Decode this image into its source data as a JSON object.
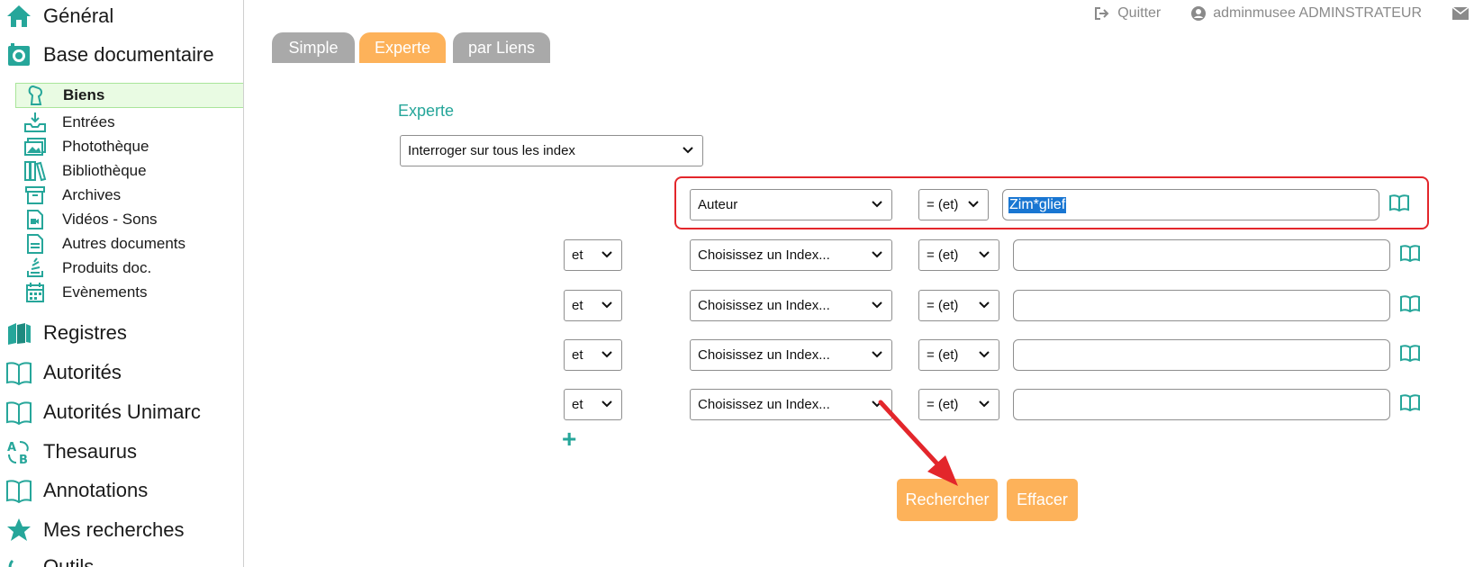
{
  "sidebar": {
    "sections_top": [
      {
        "label": "Général",
        "icon": "home-icon"
      },
      {
        "label": "Base documentaire",
        "icon": "database-icon"
      }
    ],
    "sub_items": [
      {
        "label": "Biens",
        "icon": "statue-icon",
        "active": true
      },
      {
        "label": "Entrées",
        "icon": "inbox-icon"
      },
      {
        "label": "Photothèque",
        "icon": "images-icon"
      },
      {
        "label": "Bibliothèque",
        "icon": "books-icon"
      },
      {
        "label": "Archives",
        "icon": "archive-box-icon"
      },
      {
        "label": "Vidéos - Sons",
        "icon": "video-file-icon"
      },
      {
        "label": "Autres documents",
        "icon": "document-icon"
      },
      {
        "label": "Produits doc.",
        "icon": "stack-icon"
      },
      {
        "label": "Evènements",
        "icon": "calendar-icon"
      }
    ],
    "sections_bottom": [
      {
        "label": "Registres",
        "icon": "registers-icon"
      },
      {
        "label": "Autorités",
        "icon": "open-book-icon"
      },
      {
        "label": "Autorités Unimarc",
        "icon": "open-book-icon"
      },
      {
        "label": "Thesaurus",
        "icon": "thesaurus-icon"
      },
      {
        "label": "Annotations",
        "icon": "open-book-icon"
      },
      {
        "label": "Mes recherches",
        "icon": "star-icon"
      },
      {
        "label": "Outils",
        "icon": "tools-icon"
      }
    ]
  },
  "header": {
    "quit_label": "Quitter",
    "user_label": "adminmusee ADMINSTRATEUR"
  },
  "tabs": [
    {
      "label": "Simple",
      "active": false
    },
    {
      "label": "Experte",
      "active": true
    },
    {
      "label": "par Liens",
      "active": false
    }
  ],
  "form": {
    "title": "Experte",
    "index_scope": "Interroger sur tous les index",
    "rows": [
      {
        "connector": null,
        "index": "Auteur",
        "operator": "= (et)",
        "value": "Zim*glief"
      },
      {
        "connector": "et",
        "index": "Choisissez un Index...",
        "operator": "= (et)",
        "value": ""
      },
      {
        "connector": "et",
        "index": "Choisissez un Index...",
        "operator": "= (et)",
        "value": ""
      },
      {
        "connector": "et",
        "index": "Choisissez un Index...",
        "operator": "= (et)",
        "value": ""
      },
      {
        "connector": "et",
        "index": "Choisissez un Index...",
        "operator": "= (et)",
        "value": ""
      }
    ],
    "add_row_symbol": "+",
    "search_label": "Rechercher",
    "clear_label": "Effacer"
  },
  "colors": {
    "accent_teal": "#26a69a",
    "tab_orange": "#fdb25a",
    "tab_gray": "#a9a9a9",
    "highlight_red": "#e3262b",
    "selection_blue": "#1976d2"
  }
}
